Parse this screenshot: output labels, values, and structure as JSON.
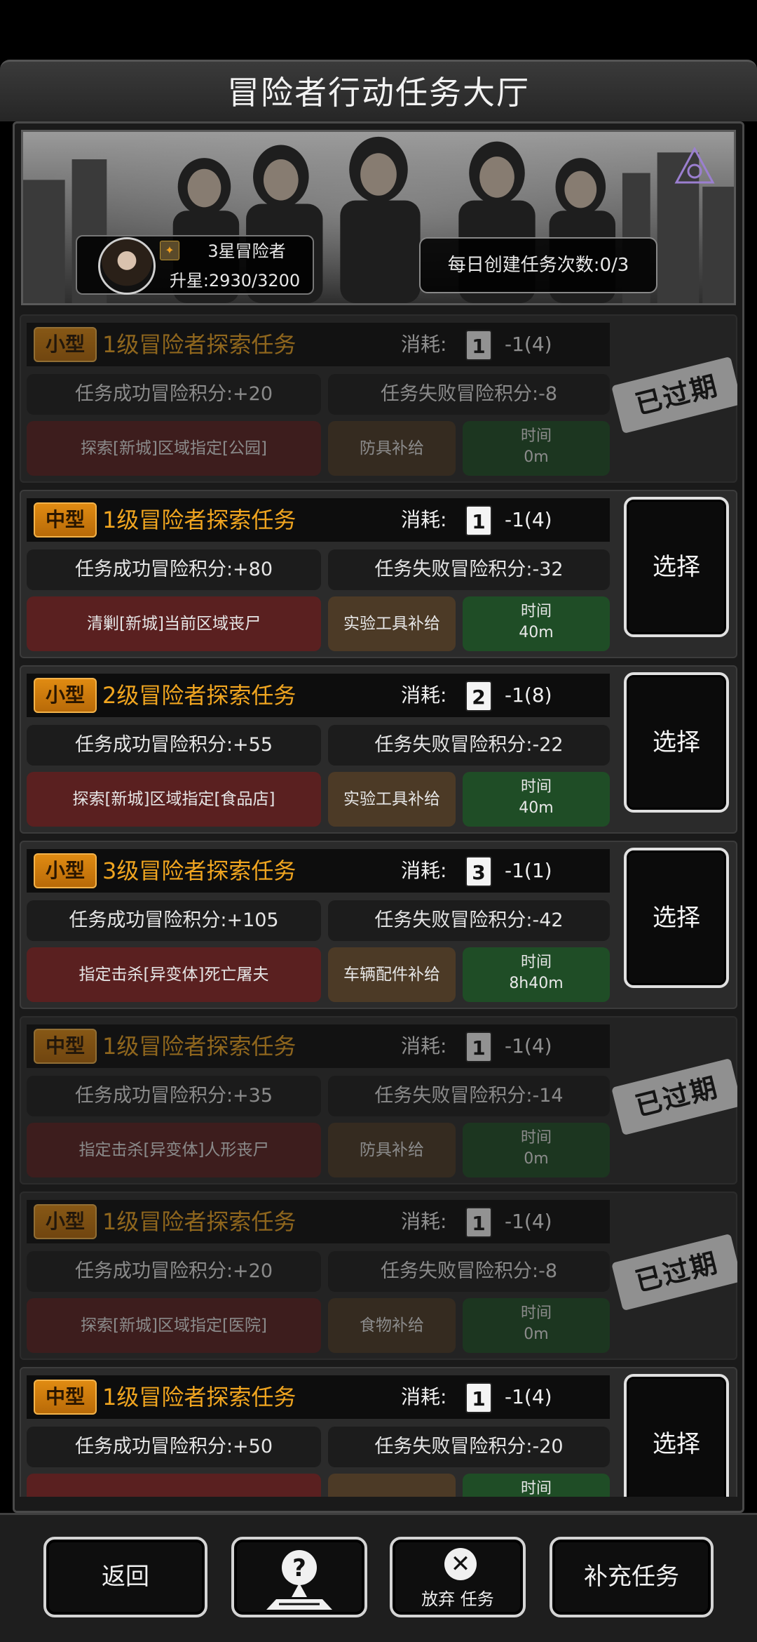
{
  "header": {
    "title": "冒险者行动任务大厅"
  },
  "profile": {
    "rank_name": "3星冒险者",
    "upgrade_progress": "升星:2930/3200",
    "daily_create": "每日创建任务次数:0/3"
  },
  "labels": {
    "cost": "消耗:",
    "select": "选择",
    "expired": "已过期",
    "time": "时间"
  },
  "tasks": [
    {
      "size": "小型",
      "title": "1级冒险者探索任务",
      "ticket_level": "1",
      "cost": "-1(4)",
      "success": "任务成功冒险积分:+20",
      "fail": "任务失败冒险积分:-8",
      "mission": "探索[新城]区域指定[公园]",
      "reward": "防具补给",
      "time": "0m",
      "status": "expired"
    },
    {
      "size": "中型",
      "title": "1级冒险者探索任务",
      "ticket_level": "1",
      "cost": "-1(4)",
      "success": "任务成功冒险积分:+80",
      "fail": "任务失败冒险积分:-32",
      "mission": "清剿[新城]当前区域丧尸",
      "reward": "实验工具补给",
      "time": "40m",
      "status": "available"
    },
    {
      "size": "小型",
      "title": "2级冒险者探索任务",
      "ticket_level": "2",
      "cost": "-1(8)",
      "success": "任务成功冒险积分:+55",
      "fail": "任务失败冒险积分:-22",
      "mission": "探索[新城]区域指定[食品店]",
      "reward": "实验工具补给",
      "time": "40m",
      "status": "available"
    },
    {
      "size": "小型",
      "title": "3级冒险者探索任务",
      "ticket_level": "3",
      "cost": "-1(1)",
      "success": "任务成功冒险积分:+105",
      "fail": "任务失败冒险积分:-42",
      "mission": "指定击杀[异变体]死亡屠夫",
      "reward": "车辆配件补给",
      "time": "8h40m",
      "status": "available"
    },
    {
      "size": "中型",
      "title": "1级冒险者探索任务",
      "ticket_level": "1",
      "cost": "-1(4)",
      "success": "任务成功冒险积分:+35",
      "fail": "任务失败冒险积分:-14",
      "mission": "指定击杀[异变体]人形丧尸",
      "reward": "防具补给",
      "time": "0m",
      "status": "expired"
    },
    {
      "size": "小型",
      "title": "1级冒险者探索任务",
      "ticket_level": "1",
      "cost": "-1(4)",
      "success": "任务成功冒险积分:+20",
      "fail": "任务失败冒险积分:-8",
      "mission": "探索[新城]区域指定[医院]",
      "reward": "食物补给",
      "time": "0m",
      "status": "expired"
    },
    {
      "size": "中型",
      "title": "1级冒险者探索任务",
      "ticket_level": "1",
      "cost": "-1(4)",
      "success": "任务成功冒险积分:+50",
      "fail": "任务失败冒险积分:-20",
      "mission": "",
      "reward": "",
      "time": "",
      "status": "available"
    }
  ],
  "bottom": {
    "back": "返回",
    "abandon": "放弃 任务",
    "refill": "补充任务"
  },
  "icons": {
    "banner_logo": "biohazard-triangle-icon",
    "help": "help-map-icon",
    "abandon": "close-circle-icon",
    "ticket": "ticket-icon"
  },
  "colors": {
    "task_title": "#f0a520",
    "badge": "#d88510",
    "mission_bg": "#5a2020",
    "reward_bg": "#4c3a26",
    "time_bg": "#1f4d26"
  }
}
